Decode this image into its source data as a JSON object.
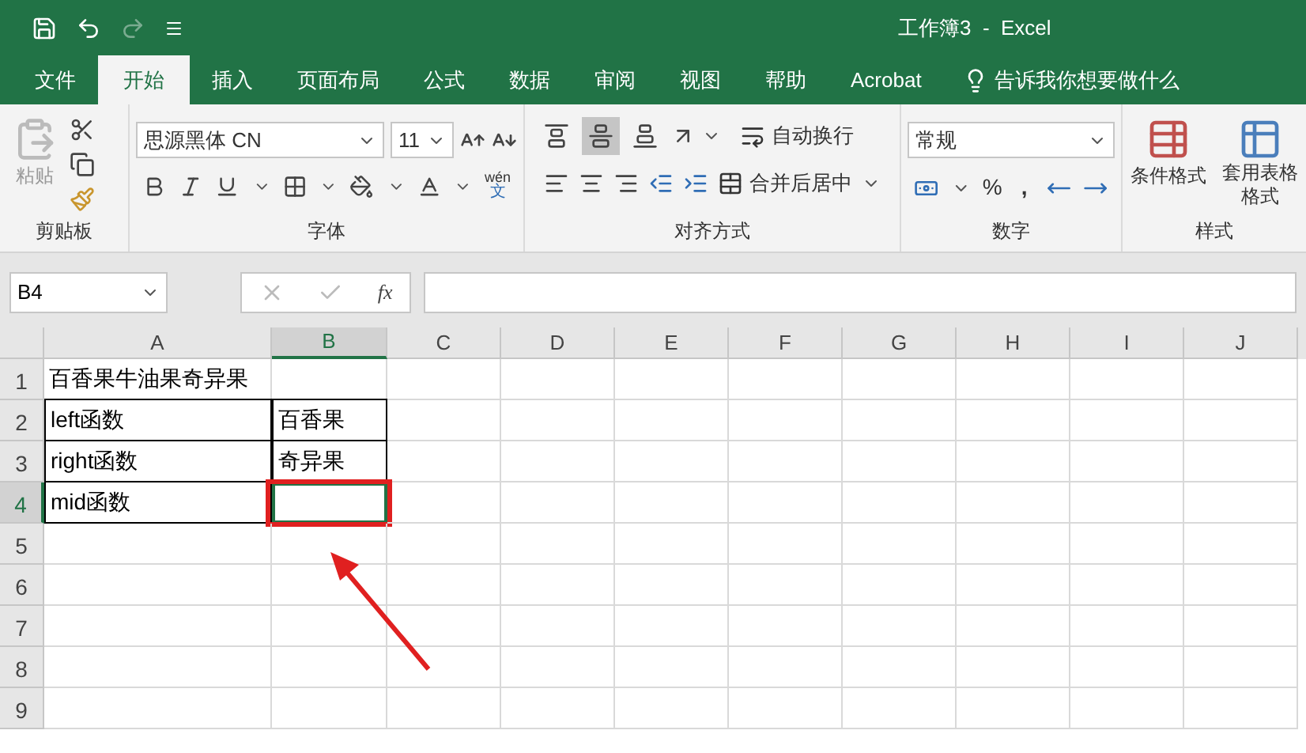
{
  "title_bar": {
    "title": "工作簿3  -  Excel"
  },
  "menu_tabs": [
    {
      "label": "文件",
      "selected": false
    },
    {
      "label": "开始",
      "selected": true
    },
    {
      "label": "插入",
      "selected": false
    },
    {
      "label": "页面布局",
      "selected": false
    },
    {
      "label": "公式",
      "selected": false
    },
    {
      "label": "数据",
      "selected": false
    },
    {
      "label": "审阅",
      "selected": false
    },
    {
      "label": "视图",
      "selected": false
    },
    {
      "label": "帮助",
      "selected": false
    },
    {
      "label": "Acrobat",
      "selected": false
    }
  ],
  "tell_me": "告诉我你想要做什么",
  "ribbon": {
    "clipboard": {
      "paste": "粘贴",
      "label": "剪贴板"
    },
    "font": {
      "font_name": "思源黑体 CN",
      "font_size": "11",
      "phonetic": "wén",
      "phonetic_char": "文",
      "label": "字体"
    },
    "alignment": {
      "vertical": [
        {
          "selected": false
        },
        {
          "selected": true
        },
        {
          "selected": false
        }
      ],
      "wrap_text": "自动换行",
      "merge": "合并后居中",
      "label": "对齐方式"
    },
    "number": {
      "format": "常规",
      "percent": "%",
      "comma": ",",
      "label": "数字"
    },
    "styles": {
      "conditional": "条件格式",
      "table_format": "套用表格格式",
      "label": "样式"
    }
  },
  "formula_bar": {
    "name_box": "B4",
    "fx": "fx"
  },
  "sheet": {
    "columns": [
      {
        "label": "A",
        "selected": false
      },
      {
        "label": "B",
        "selected": true
      },
      {
        "label": "C",
        "selected": false
      },
      {
        "label": "D",
        "selected": false
      },
      {
        "label": "E",
        "selected": false
      },
      {
        "label": "F",
        "selected": false
      },
      {
        "label": "G",
        "selected": false
      },
      {
        "label": "H",
        "selected": false
      },
      {
        "label": "I",
        "selected": false
      },
      {
        "label": "J",
        "selected": false
      }
    ],
    "rows": [
      {
        "number": "1",
        "selected": false,
        "bordered": false,
        "cells": [
          {
            "text": "百香果牛油果奇异果",
            "selected": false
          },
          {
            "text": "",
            "selected": false
          }
        ]
      },
      {
        "number": "2",
        "selected": false,
        "bordered": true,
        "cells": [
          {
            "text": "left函数",
            "selected": false
          },
          {
            "text": "百香果",
            "selected": false
          }
        ]
      },
      {
        "number": "3",
        "selected": false,
        "bordered": true,
        "cells": [
          {
            "text": "right函数",
            "selected": false
          },
          {
            "text": "奇异果",
            "selected": false
          }
        ]
      },
      {
        "number": "4",
        "selected": true,
        "bordered": true,
        "cells": [
          {
            "text": "mid函数",
            "selected": false
          },
          {
            "text": "",
            "selected": true
          }
        ]
      },
      {
        "number": "5",
        "selected": false,
        "bordered": false,
        "cells": []
      },
      {
        "number": "6",
        "selected": false,
        "bordered": false,
        "cells": []
      },
      {
        "number": "7",
        "selected": false,
        "bordered": false,
        "cells": []
      },
      {
        "number": "8",
        "selected": false,
        "bordered": false,
        "cells": []
      },
      {
        "number": "9",
        "selected": false,
        "bordered": false,
        "cells": []
      }
    ]
  }
}
